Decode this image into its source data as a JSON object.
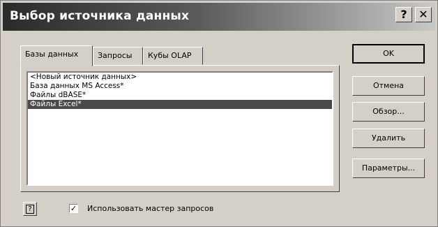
{
  "window": {
    "title": "Выбор источника данных",
    "help_caption": "?",
    "close_caption": "✕"
  },
  "tabs": [
    {
      "label": "Базы данных",
      "active": true
    },
    {
      "label": "Запросы",
      "active": false
    },
    {
      "label": "Кубы OLAP",
      "active": false
    }
  ],
  "list": {
    "items": [
      {
        "label": "<Новый источник данных>",
        "selected": false
      },
      {
        "label": "База данных MS Access*",
        "selected": false
      },
      {
        "label": "Файлы dBASE*",
        "selected": false
      },
      {
        "label": "Файлы Excel*",
        "selected": true
      }
    ]
  },
  "buttons": {
    "ok": "OK",
    "cancel": "Отмена",
    "browse": "Обзор...",
    "delete": "Удалить",
    "params": "Параметры..."
  },
  "footer": {
    "help_glyph": "?",
    "checkbox_checked": true,
    "checkbox_mark": "✓",
    "checkbox_label": "Использовать мастер запросов"
  }
}
